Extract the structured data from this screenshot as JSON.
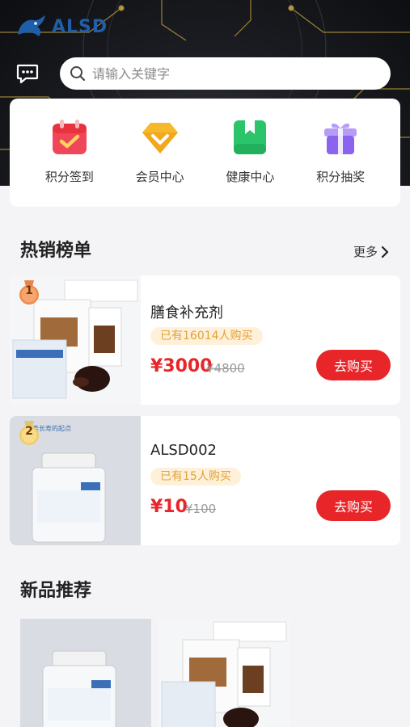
{
  "header": {
    "logo_text": "ALSD",
    "search_placeholder": "请输入关键字"
  },
  "quick_links": [
    {
      "label": "积分签到",
      "icon": "calendar-check-icon",
      "color": "#f0465a"
    },
    {
      "label": "会员中心",
      "icon": "diamond-icon",
      "color": "#f5b92a"
    },
    {
      "label": "健康中心",
      "icon": "book-icon",
      "color": "#2cc46b"
    },
    {
      "label": "积分抽奖",
      "icon": "gift-icon",
      "color": "#8a63ef"
    }
  ],
  "hot": {
    "title": "热销榜单",
    "more_label": "更多",
    "items": [
      {
        "rank": "1",
        "name": "膳食补充剂",
        "badge": "已有16014人购买",
        "price": "¥3000",
        "old_price": "¥4800",
        "buy_label": "去购买"
      },
      {
        "rank": "2",
        "name": "ALSD002",
        "badge": "已有15人购买",
        "price": "¥10",
        "old_price": "¥100",
        "buy_label": "去购买"
      }
    ]
  },
  "new_products": {
    "title": "新品推荐"
  },
  "colors": {
    "accent": "#e8262a",
    "badge_bg": "#fff1d9",
    "badge_text": "#e0a13a",
    "logo": "#1f5ea8"
  }
}
